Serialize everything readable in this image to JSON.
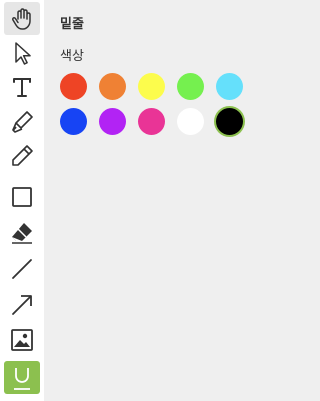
{
  "tools": [
    {
      "name": "hand-tool",
      "icon": "hand-icon",
      "state": "hover"
    },
    {
      "name": "select-tool",
      "icon": "cursor-arrow-icon",
      "state": "normal"
    },
    {
      "name": "text-tool",
      "icon": "text-t-icon",
      "state": "normal"
    },
    {
      "name": "marker-tool",
      "icon": "marker-icon",
      "state": "normal"
    },
    {
      "name": "pencil-tool",
      "icon": "pencil-icon",
      "state": "normal"
    },
    {
      "name": "rectangle-tool",
      "icon": "rectangle-icon",
      "state": "normal"
    },
    {
      "name": "eraser-tool",
      "icon": "eraser-icon",
      "state": "normal"
    },
    {
      "name": "line-tool",
      "icon": "line-icon",
      "state": "normal"
    },
    {
      "name": "arrow-tool",
      "icon": "arrow-icon",
      "state": "normal"
    },
    {
      "name": "image-tool",
      "icon": "image-icon",
      "state": "normal"
    },
    {
      "name": "underline-tool",
      "icon": "underline-icon",
      "state": "active"
    }
  ],
  "panel": {
    "title": "밑줄",
    "color_label": "색상"
  },
  "colors": [
    {
      "name": "red",
      "hex": "#ee4425"
    },
    {
      "name": "orange",
      "hex": "#ef8134"
    },
    {
      "name": "yellow",
      "hex": "#fcfc4c"
    },
    {
      "name": "green",
      "hex": "#75f04f"
    },
    {
      "name": "cyan",
      "hex": "#65e0fb"
    },
    {
      "name": "blue",
      "hex": "#1744f4"
    },
    {
      "name": "purple",
      "hex": "#b223f4"
    },
    {
      "name": "pink",
      "hex": "#e93496"
    },
    {
      "name": "white",
      "hex": "#ffffff"
    },
    {
      "name": "black",
      "hex": "#000000",
      "selected": true
    }
  ],
  "theme": {
    "active_accent": "#8cc04f",
    "icon_color": "#333333"
  }
}
